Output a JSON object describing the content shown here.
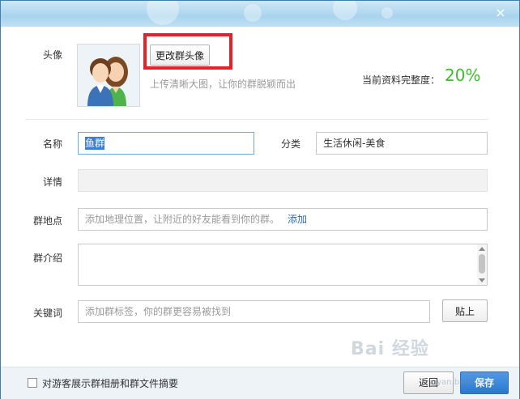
{
  "window": {
    "close_glyph": "×"
  },
  "avatar": {
    "label": "头像",
    "change_button": "更改群头像",
    "hint": "上传清晰大图，让你的群脱颖而出",
    "completeness_label": "当前资料完整度：",
    "completeness_value": "20%",
    "completeness_percent": 20
  },
  "form": {
    "name_label": "名称",
    "name_value": "鱼群",
    "category_label": "分类",
    "category_value": "生活休闲-美食",
    "detail_label": "详情",
    "detail_value": "",
    "location_label": "群地点",
    "location_placeholder": "添加地理位置，让附近的好友能看到你的群。",
    "location_add_link": "添加",
    "intro_label": "群介绍",
    "intro_value": "",
    "keyword_label": "关键词",
    "keyword_placeholder": "添加群标签，你的群更容易被找到",
    "paste_button": "贴上"
  },
  "footer": {
    "checkbox_label": "对游客展示群相册和群文件摘要",
    "checkbox_checked": false,
    "back_button": "返回",
    "save_button": "保存"
  },
  "watermark": {
    "main": "Bai 经验",
    "sub": "jingyan.baidu.com"
  },
  "colors": {
    "accent": "#3cbf2a",
    "highlight_border": "#e8202a",
    "primary_button": "#2c78d0",
    "link": "#2b6cb0"
  }
}
